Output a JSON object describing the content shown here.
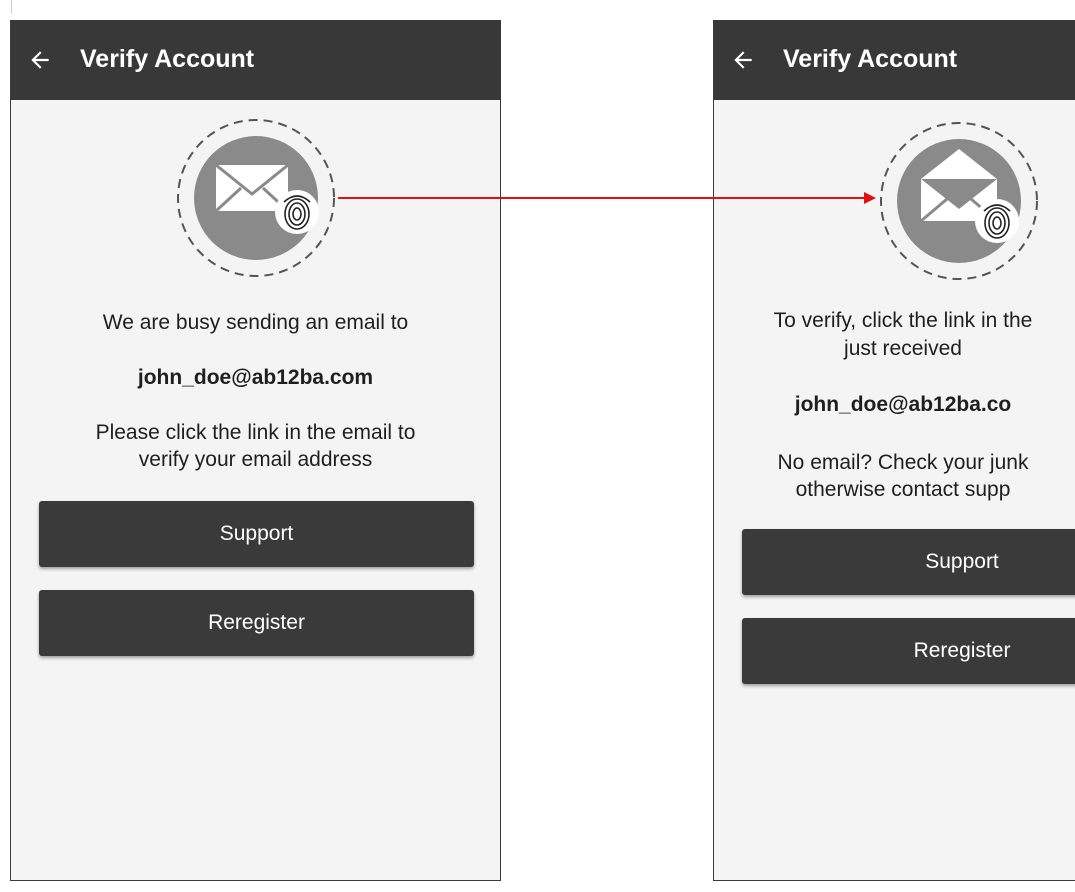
{
  "colors": {
    "appbar": "#383838",
    "screen_background": "#f4f4f4",
    "button": "#3a3a3a",
    "connector_arrow": "#e01010",
    "icon_circle": "#8a8a8a"
  },
  "screens": [
    {
      "appbar": {
        "back_icon": "arrow-left-icon",
        "title": "Verify Account"
      },
      "badge_icon": "envelope-closed-fingerprint-icon",
      "message_line_1": "We are busy sending an email to",
      "email": "john_doe@ab12ba.com",
      "instruction_line_1": "Please click the link in the email to",
      "instruction_line_2": "verify your email address",
      "support_label": "Support",
      "reregister_label": "Reregister"
    },
    {
      "appbar": {
        "back_icon": "arrow-left-icon",
        "title": "Verify Account"
      },
      "badge_icon": "envelope-open-fingerprint-icon",
      "message_line_1": "To verify, click the link in the",
      "message_line_2": "just received",
      "email": "john_doe@ab12ba.co",
      "instruction_line_1": "No email? Check your junk",
      "instruction_line_2": "otherwise contact supp",
      "support_label": "Support",
      "reregister_label": "Reregister"
    }
  ]
}
